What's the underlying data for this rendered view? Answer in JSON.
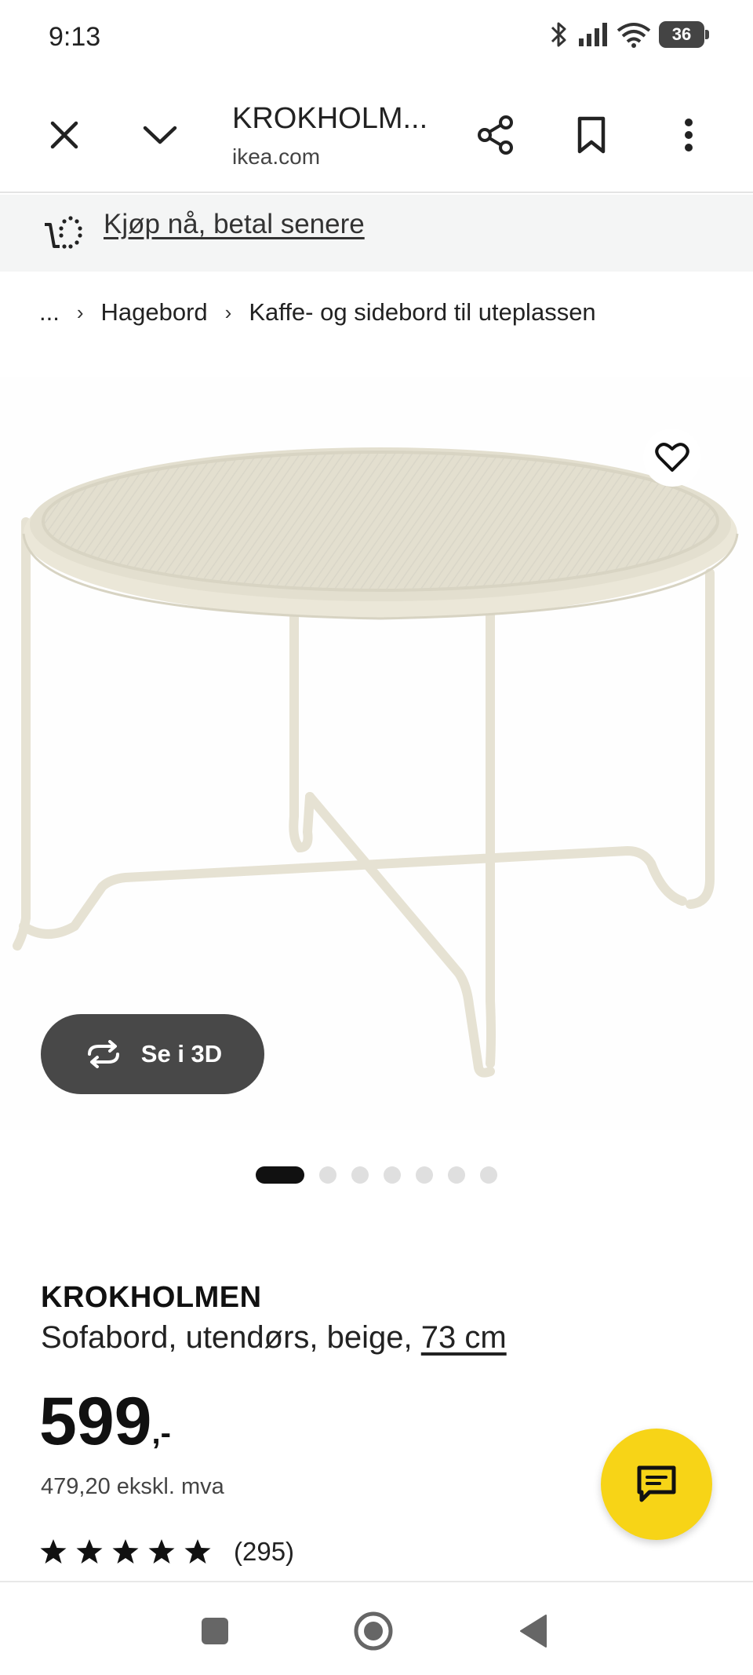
{
  "status_bar": {
    "time": "9:13",
    "battery": "36",
    "icons": [
      "bluetooth-icon",
      "signal-icon",
      "wifi-icon",
      "battery-icon"
    ]
  },
  "toolbar": {
    "title": "KROKHOLM...",
    "url": "ikea.com",
    "icons": [
      "close-icon",
      "chevron-down-icon",
      "share-icon",
      "bookmark-icon",
      "more-vert-icon"
    ]
  },
  "promo": {
    "link_text": "Kjøp nå, betal senere",
    "icon": "cart-dotted-icon"
  },
  "breadcrumb": {
    "items": [
      "...",
      "Hagebord",
      "Kaffe- og sidebord til uteplassen"
    ],
    "separator": "›"
  },
  "gallery": {
    "button_3d_label": "Se i 3D",
    "total_images": 7,
    "active_index": 0,
    "icons": [
      "heart-icon",
      "rotate-3d-icon"
    ]
  },
  "product": {
    "name": "KROKHOLMEN",
    "description": "Sofabord, utendørs, beige,",
    "size_link": "73 cm",
    "price_main": "599",
    "price_suffix": ",-",
    "price_ex_vat": "479,20 ekskl. mva",
    "rating_stars": 5,
    "rating_count": "(295)"
  },
  "chat": {
    "icon": "chat-bubble-icon"
  },
  "colors": {
    "chat_yellow": "#f7d417",
    "button_3d_bg": "#484848",
    "promo_bg": "#f4f5f5"
  },
  "navbar": {
    "icons": [
      "recents-square-icon",
      "home-circle-icon",
      "back-triangle-icon"
    ]
  }
}
